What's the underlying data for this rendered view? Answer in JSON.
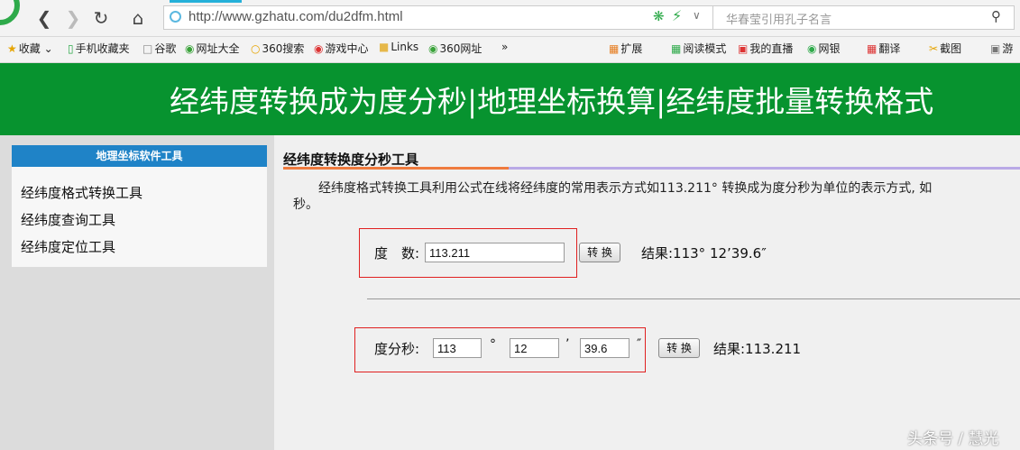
{
  "browser": {
    "url": "http://www.gzhatu.com/du2dfm.html",
    "search_placeholder": "华春莹引用孔子名言"
  },
  "bookmarks": {
    "left": [
      "收藏",
      "手机收藏夹",
      "谷歌",
      "网址大全",
      "360搜索",
      "游戏中心",
      "Links",
      "360网址"
    ],
    "more": "»",
    "right": [
      "扩展",
      "阅读模式",
      "我的直播",
      "网银",
      "翻译",
      "截图",
      "游"
    ]
  },
  "page": {
    "banner_title": "经纬度转换成为度分秒|地理坐标换算|经纬度批量转换格式",
    "sidebar": {
      "header": "地理坐标软件工具",
      "links": [
        "经纬度格式转换工具",
        "经纬度查询工具",
        "经纬度定位工具"
      ]
    },
    "content": {
      "title": "经纬度转换度分秒工具",
      "intro_line1": "经纬度格式转换工具利用公式在线将经纬度的常用表示方式如113.211° 转换成为度分秒为单位的表示方式, 如",
      "intro_line2": "秒。",
      "form1": {
        "label": "度　数:",
        "value": "113.211",
        "button": "转 换",
        "result": "结果:113° 12’39.6″"
      },
      "form2": {
        "label": "度分秒:",
        "deg_value": "113",
        "deg_symbol": "°",
        "min_value": "12",
        "min_symbol": "’",
        "sec_value": "39.6",
        "sec_symbol": "″",
        "button": "转 换",
        "result": "结果:113.211"
      }
    }
  },
  "watermark": "头条号 / 慧光"
}
